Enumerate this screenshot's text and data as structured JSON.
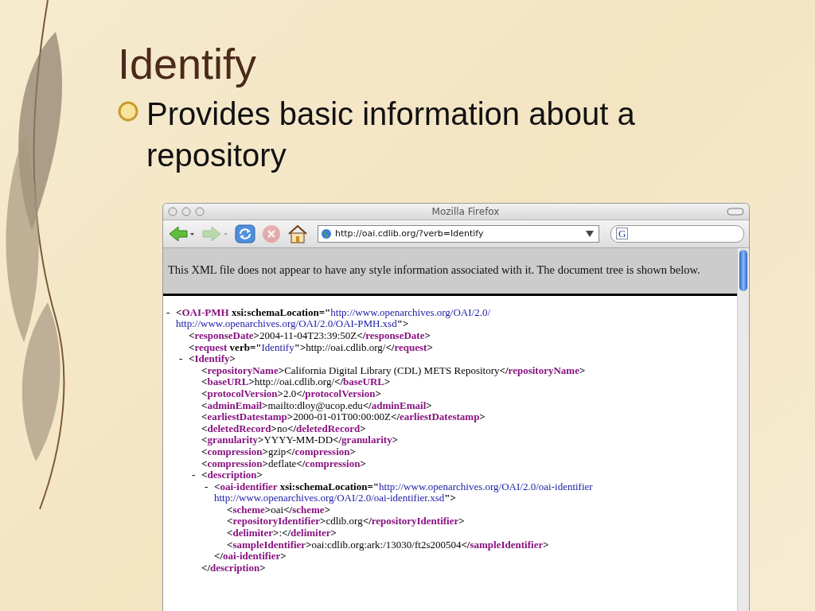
{
  "slide": {
    "title": "Identify",
    "bullets": [
      {
        "text": "Provides basic information about a repository"
      }
    ]
  },
  "browser": {
    "title": "Mozilla Firefox",
    "nav": [
      {
        "kind": "back",
        "disabled": false
      },
      {
        "kind": "forward",
        "disabled": true
      },
      {
        "kind": "reload",
        "disabled": false
      },
      {
        "kind": "stop",
        "disabled": true
      },
      {
        "kind": "home",
        "disabled": false
      }
    ],
    "url": "http://oai.cdlib.org/?verb=Identify",
    "search_engine": "G",
    "banner": "This XML file does not appear to have any style information associated with it. The document tree is shown below.",
    "xml": [
      {
        "toggle": "-",
        "lines": [
          [
            {
              "kind": "punct",
              "text": "<"
            },
            {
              "kind": "tag",
              "text": "OAI-PMH"
            },
            {
              "kind": "attr",
              "text": " xsi:schemaLocation"
            },
            {
              "kind": "punct",
              "text": "=\""
            },
            {
              "kind": "value",
              "text": "http://www.openarchives.org/OAI/2.0/"
            }
          ],
          [
            {
              "kind": "value",
              "text": "http://www.openarchives.org/OAI/2.0/OAI-PMH.xsd"
            },
            {
              "kind": "punct",
              "text": "\">"
            }
          ]
        ],
        "children": [
          {
            "lines": [
              [
                {
                  "kind": "punct",
                  "text": "<"
                },
                {
                  "kind": "tag",
                  "text": "responseDate"
                },
                {
                  "kind": "punct",
                  "text": ">"
                },
                {
                  "kind": "text",
                  "text": "2004-11-04T23:39:50Z"
                },
                {
                  "kind": "punct",
                  "text": "</"
                },
                {
                  "kind": "tag",
                  "text": "responseDate"
                },
                {
                  "kind": "punct",
                  "text": ">"
                }
              ]
            ]
          },
          {
            "lines": [
              [
                {
                  "kind": "punct",
                  "text": "<"
                },
                {
                  "kind": "tag",
                  "text": "request"
                },
                {
                  "kind": "attr",
                  "text": " verb"
                },
                {
                  "kind": "punct",
                  "text": "=\""
                },
                {
                  "kind": "value",
                  "text": "Identify"
                },
                {
                  "kind": "punct",
                  "text": "\">"
                },
                {
                  "kind": "text",
                  "text": "http://oai.cdlib.org/"
                },
                {
                  "kind": "punct",
                  "text": "</"
                },
                {
                  "kind": "tag",
                  "text": "request"
                },
                {
                  "kind": "punct",
                  "text": ">"
                }
              ]
            ]
          },
          {
            "toggle": "-",
            "lines": [
              [
                {
                  "kind": "punct",
                  "text": "<"
                },
                {
                  "kind": "tag",
                  "text": "Identify"
                },
                {
                  "kind": "punct",
                  "text": ">"
                }
              ]
            ],
            "children": [
              {
                "lines": [
                  [
                    {
                      "kind": "punct",
                      "text": "<"
                    },
                    {
                      "kind": "tag",
                      "text": "repositoryName"
                    },
                    {
                      "kind": "punct",
                      "text": ">"
                    },
                    {
                      "kind": "text",
                      "text": "California Digital Library (CDL) METS Repository"
                    },
                    {
                      "kind": "punct",
                      "text": "</"
                    },
                    {
                      "kind": "tag",
                      "text": "repositoryName"
                    },
                    {
                      "kind": "punct",
                      "text": ">"
                    }
                  ]
                ]
              },
              {
                "lines": [
                  [
                    {
                      "kind": "punct",
                      "text": "<"
                    },
                    {
                      "kind": "tag",
                      "text": "baseURL"
                    },
                    {
                      "kind": "punct",
                      "text": ">"
                    },
                    {
                      "kind": "text",
                      "text": "http://oai.cdlib.org/"
                    },
                    {
                      "kind": "punct",
                      "text": "</"
                    },
                    {
                      "kind": "tag",
                      "text": "baseURL"
                    },
                    {
                      "kind": "punct",
                      "text": ">"
                    }
                  ]
                ]
              },
              {
                "lines": [
                  [
                    {
                      "kind": "punct",
                      "text": "<"
                    },
                    {
                      "kind": "tag",
                      "text": "protocolVersion"
                    },
                    {
                      "kind": "punct",
                      "text": ">"
                    },
                    {
                      "kind": "text",
                      "text": "2.0"
                    },
                    {
                      "kind": "punct",
                      "text": "</"
                    },
                    {
                      "kind": "tag",
                      "text": "protocolVersion"
                    },
                    {
                      "kind": "punct",
                      "text": ">"
                    }
                  ]
                ]
              },
              {
                "lines": [
                  [
                    {
                      "kind": "punct",
                      "text": "<"
                    },
                    {
                      "kind": "tag",
                      "text": "adminEmail"
                    },
                    {
                      "kind": "punct",
                      "text": ">"
                    },
                    {
                      "kind": "text",
                      "text": "mailto:dloy@ucop.edu"
                    },
                    {
                      "kind": "punct",
                      "text": "</"
                    },
                    {
                      "kind": "tag",
                      "text": "adminEmail"
                    },
                    {
                      "kind": "punct",
                      "text": ">"
                    }
                  ]
                ]
              },
              {
                "lines": [
                  [
                    {
                      "kind": "punct",
                      "text": "<"
                    },
                    {
                      "kind": "tag",
                      "text": "earliestDatestamp"
                    },
                    {
                      "kind": "punct",
                      "text": ">"
                    },
                    {
                      "kind": "text",
                      "text": "2000-01-01T00:00:00Z"
                    },
                    {
                      "kind": "punct",
                      "text": "</"
                    },
                    {
                      "kind": "tag",
                      "text": "earliestDatestamp"
                    },
                    {
                      "kind": "punct",
                      "text": ">"
                    }
                  ]
                ]
              },
              {
                "lines": [
                  [
                    {
                      "kind": "punct",
                      "text": "<"
                    },
                    {
                      "kind": "tag",
                      "text": "deletedRecord"
                    },
                    {
                      "kind": "punct",
                      "text": ">"
                    },
                    {
                      "kind": "text",
                      "text": "no"
                    },
                    {
                      "kind": "punct",
                      "text": "</"
                    },
                    {
                      "kind": "tag",
                      "text": "deletedRecord"
                    },
                    {
                      "kind": "punct",
                      "text": ">"
                    }
                  ]
                ]
              },
              {
                "lines": [
                  [
                    {
                      "kind": "punct",
                      "text": "<"
                    },
                    {
                      "kind": "tag",
                      "text": "granularity"
                    },
                    {
                      "kind": "punct",
                      "text": ">"
                    },
                    {
                      "kind": "text",
                      "text": "YYYY-MM-DD"
                    },
                    {
                      "kind": "punct",
                      "text": "</"
                    },
                    {
                      "kind": "tag",
                      "text": "granularity"
                    },
                    {
                      "kind": "punct",
                      "text": ">"
                    }
                  ]
                ]
              },
              {
                "lines": [
                  [
                    {
                      "kind": "punct",
                      "text": "<"
                    },
                    {
                      "kind": "tag",
                      "text": "compression"
                    },
                    {
                      "kind": "punct",
                      "text": ">"
                    },
                    {
                      "kind": "text",
                      "text": "gzip"
                    },
                    {
                      "kind": "punct",
                      "text": "</"
                    },
                    {
                      "kind": "tag",
                      "text": "compression"
                    },
                    {
                      "kind": "punct",
                      "text": ">"
                    }
                  ]
                ]
              },
              {
                "lines": [
                  [
                    {
                      "kind": "punct",
                      "text": "<"
                    },
                    {
                      "kind": "tag",
                      "text": "compression"
                    },
                    {
                      "kind": "punct",
                      "text": ">"
                    },
                    {
                      "kind": "text",
                      "text": "deflate"
                    },
                    {
                      "kind": "punct",
                      "text": "</"
                    },
                    {
                      "kind": "tag",
                      "text": "compression"
                    },
                    {
                      "kind": "punct",
                      "text": ">"
                    }
                  ]
                ]
              },
              {
                "toggle": "-",
                "lines": [
                  [
                    {
                      "kind": "punct",
                      "text": "<"
                    },
                    {
                      "kind": "tag",
                      "text": "description"
                    },
                    {
                      "kind": "punct",
                      "text": ">"
                    }
                  ]
                ],
                "closing": [
                  {
                    "kind": "punct",
                    "text": "</"
                  },
                  {
                    "kind": "tag",
                    "text": "description"
                  },
                  {
                    "kind": "punct",
                    "text": ">"
                  }
                ],
                "children": [
                  {
                    "toggle": "-",
                    "lines": [
                      [
                        {
                          "kind": "punct",
                          "text": "<"
                        },
                        {
                          "kind": "tag",
                          "text": "oai-identifier"
                        },
                        {
                          "kind": "attr",
                          "text": " xsi:schemaLocation"
                        },
                        {
                          "kind": "punct",
                          "text": "=\""
                        },
                        {
                          "kind": "value",
                          "text": "http://www.openarchives.org/OAI/2.0/oai-identifier"
                        }
                      ],
                      [
                        {
                          "kind": "value",
                          "text": "http://www.openarchives.org/OAI/2.0/oai-identifier.xsd"
                        },
                        {
                          "kind": "punct",
                          "text": "\">"
                        }
                      ]
                    ],
                    "closing": [
                      {
                        "kind": "punct",
                        "text": "</"
                      },
                      {
                        "kind": "tag",
                        "text": "oai-identifier"
                      },
                      {
                        "kind": "punct",
                        "text": ">"
                      }
                    ],
                    "children": [
                      {
                        "lines": [
                          [
                            {
                              "kind": "punct",
                              "text": "<"
                            },
                            {
                              "kind": "tag",
                              "text": "scheme"
                            },
                            {
                              "kind": "punct",
                              "text": ">"
                            },
                            {
                              "kind": "text",
                              "text": "oai"
                            },
                            {
                              "kind": "punct",
                              "text": "</"
                            },
                            {
                              "kind": "tag",
                              "text": "scheme"
                            },
                            {
                              "kind": "punct",
                              "text": ">"
                            }
                          ]
                        ]
                      },
                      {
                        "lines": [
                          [
                            {
                              "kind": "punct",
                              "text": "<"
                            },
                            {
                              "kind": "tag",
                              "text": "repositoryIdentifier"
                            },
                            {
                              "kind": "punct",
                              "text": ">"
                            },
                            {
                              "kind": "text",
                              "text": "cdlib.org"
                            },
                            {
                              "kind": "punct",
                              "text": "</"
                            },
                            {
                              "kind": "tag",
                              "text": "repositoryIdentifier"
                            },
                            {
                              "kind": "punct",
                              "text": ">"
                            }
                          ]
                        ]
                      },
                      {
                        "lines": [
                          [
                            {
                              "kind": "punct",
                              "text": "<"
                            },
                            {
                              "kind": "tag",
                              "text": "delimiter"
                            },
                            {
                              "kind": "punct",
                              "text": ">"
                            },
                            {
                              "kind": "text",
                              "text": ":"
                            },
                            {
                              "kind": "punct",
                              "text": "</"
                            },
                            {
                              "kind": "tag",
                              "text": "delimiter"
                            },
                            {
                              "kind": "punct",
                              "text": ">"
                            }
                          ]
                        ]
                      },
                      {
                        "lines": [
                          [
                            {
                              "kind": "punct",
                              "text": "<"
                            },
                            {
                              "kind": "tag",
                              "text": "sampleIdentifier"
                            },
                            {
                              "kind": "punct",
                              "text": ">"
                            },
                            {
                              "kind": "text",
                              "text": "oai:cdlib.org:ark:/13030/ft2s200504"
                            },
                            {
                              "kind": "punct",
                              "text": "</"
                            },
                            {
                              "kind": "tag",
                              "text": "sampleIdentifier"
                            },
                            {
                              "kind": "punct",
                              "text": ">"
                            }
                          ]
                        ]
                      }
                    ]
                  }
                ]
              }
            ]
          }
        ]
      }
    ]
  }
}
